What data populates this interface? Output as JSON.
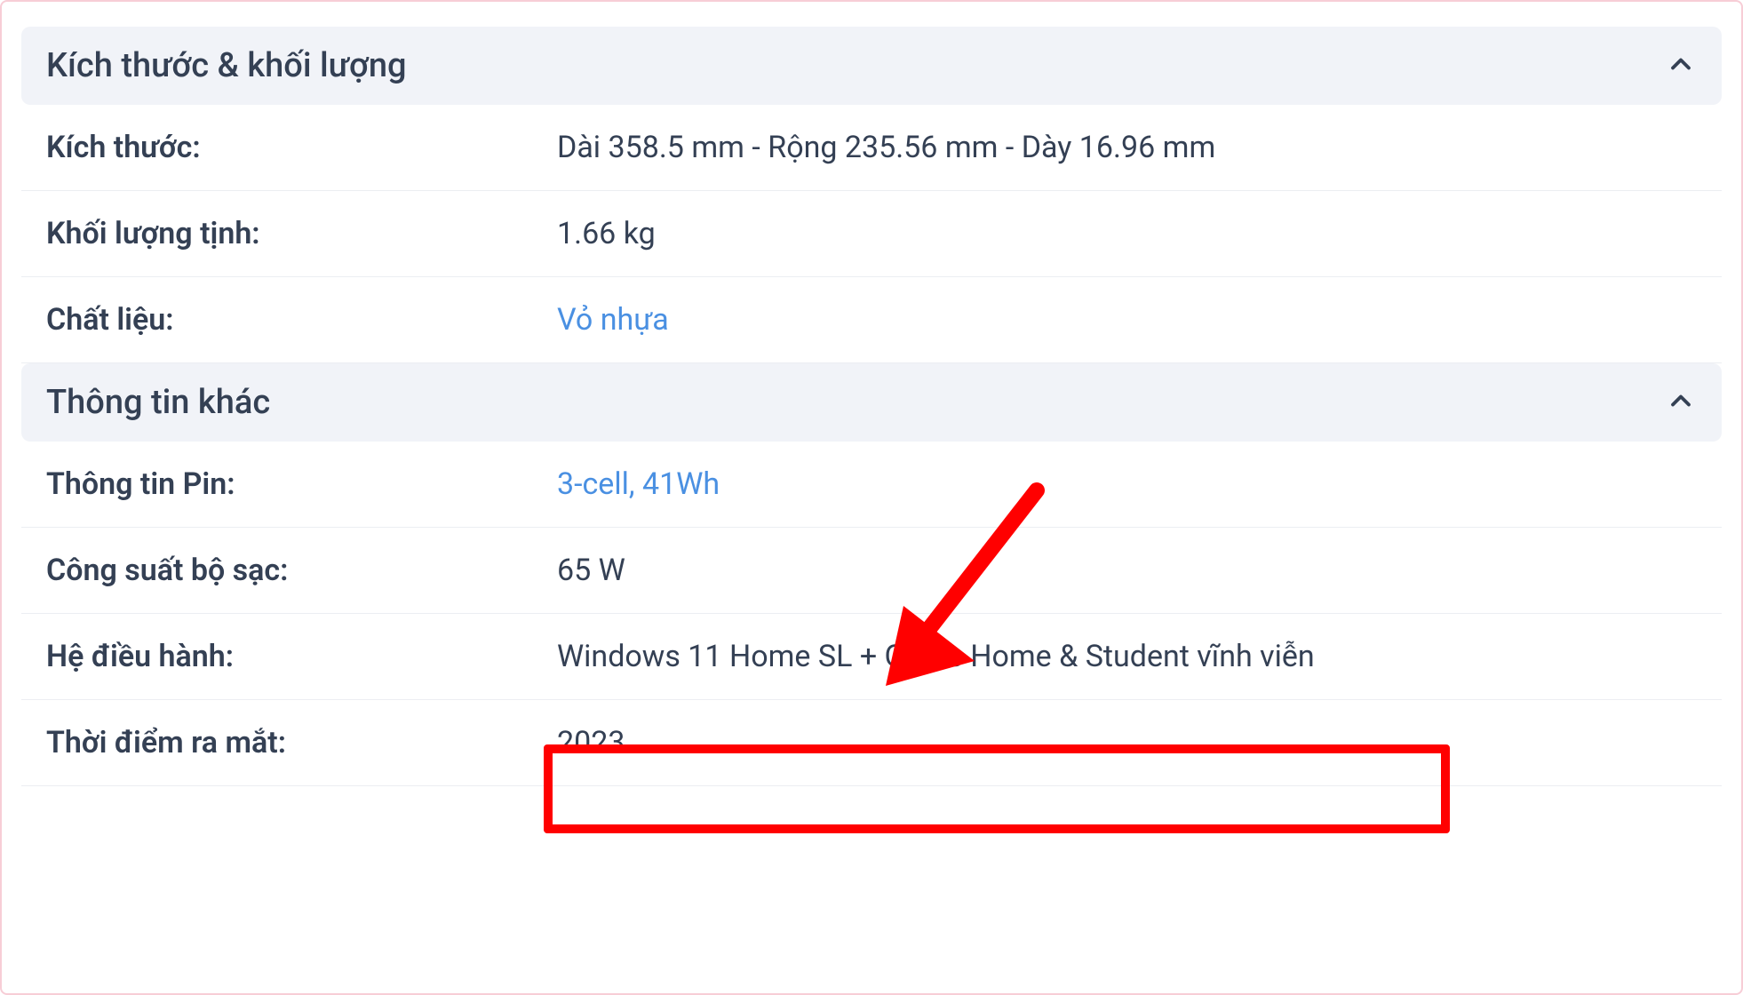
{
  "sections": [
    {
      "title": "Kích thước & khối lượng",
      "rows": [
        {
          "label": "Kích thước:",
          "value": "Dài 358.5 mm - Rộng 235.56 mm - Dày 16.96 mm",
          "is_link": false
        },
        {
          "label": "Khối lượng tịnh:",
          "value": "1.66 kg",
          "is_link": false
        },
        {
          "label": "Chất liệu:",
          "value": "Vỏ nhựa",
          "is_link": true
        }
      ]
    },
    {
      "title": "Thông tin khác",
      "rows": [
        {
          "label": "Thông tin Pin:",
          "value": "3-cell, 41Wh",
          "is_link": true
        },
        {
          "label": "Công suất bộ sạc:",
          "value": "65 W",
          "is_link": false
        },
        {
          "label": "Hệ điều hành:",
          "value": "Windows 11 Home SL + Office Home & Student vĩnh viễn",
          "is_link": false
        },
        {
          "label": "Thời điểm ra mắt:",
          "value": "2023",
          "is_link": false
        }
      ]
    }
  ]
}
